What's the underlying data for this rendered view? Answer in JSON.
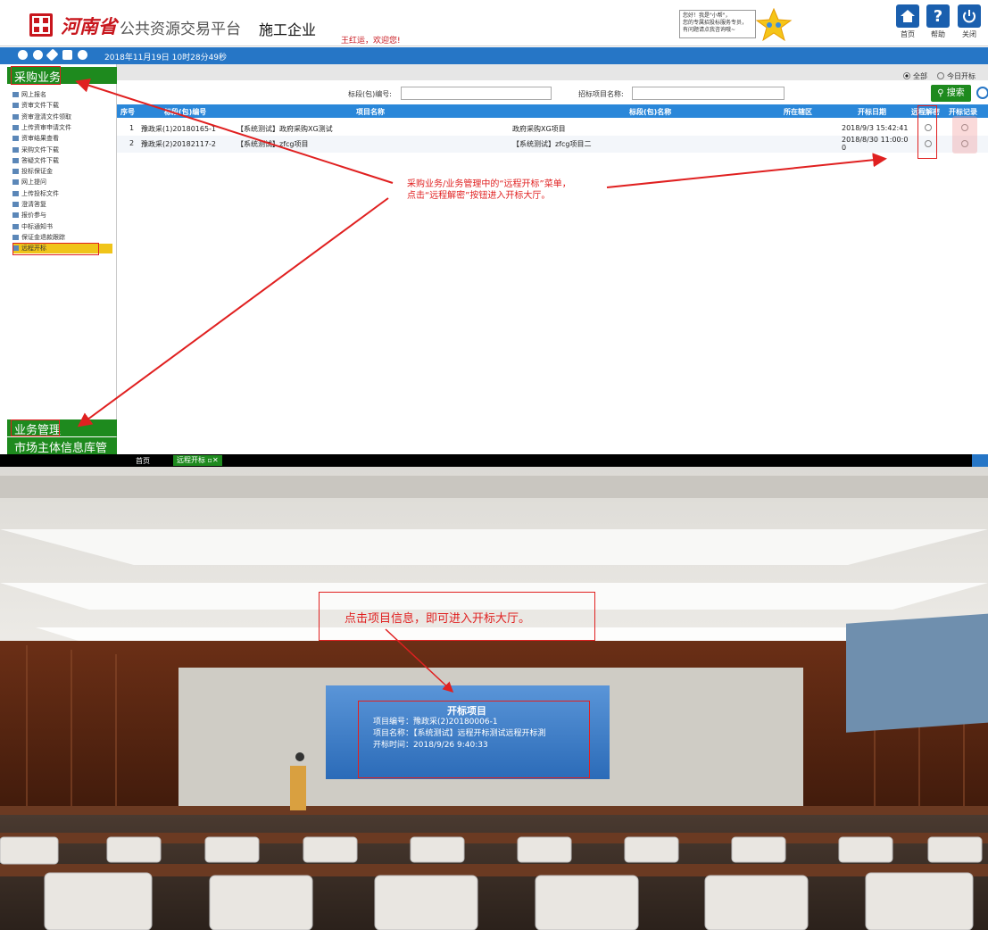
{
  "header": {
    "province": "河南省",
    "platform": "公共资源交易平台",
    "enterprise": "施工企业",
    "welcome": "王红运，欢迎您!",
    "assistant_text": "您好！我是\"小帮\"，\n您的专属招投标服务专员，\n有问题请点我咨询哦~",
    "buttons": [
      {
        "label": "首页"
      },
      {
        "label": "帮助"
      },
      {
        "label": "关闭"
      }
    ]
  },
  "toolbar": {
    "datetime": "2018年11月19日 10时28分49秒"
  },
  "sidebar": {
    "section_purchase": "采购业务",
    "items": [
      {
        "label": "网上报名"
      },
      {
        "label": "资审文件下载"
      },
      {
        "label": "资审澄清文件领取"
      },
      {
        "label": "上传资审申请文件"
      },
      {
        "label": "资审结果查看"
      },
      {
        "label": "采购文件下载"
      },
      {
        "label": "答疑文件下载"
      },
      {
        "label": "投标保证金"
      },
      {
        "label": "网上提问"
      },
      {
        "label": "上传投标文件"
      },
      {
        "label": "澄清答复"
      },
      {
        "label": "报价参与"
      },
      {
        "label": "中标通知书"
      },
      {
        "label": "保证金退款跟踪"
      },
      {
        "label": "远程开标"
      }
    ],
    "section_business": "业务管理",
    "section_market": "市场主体信息库管理"
  },
  "filters": {
    "radio_all": "全部",
    "radio_today": "今日开标",
    "section_no_label": "标段(包)编号:",
    "project_name_label": "招标项目名称:",
    "search_label": "搜索"
  },
  "table": {
    "headers": [
      "序号",
      "标段(包)编号",
      "项目名称",
      "标段(包)名称",
      "所在辖区",
      "开标日期",
      "远程解密",
      "开标记录"
    ],
    "rows": [
      {
        "no": "1",
        "code": "豫政采(1)20180165-1",
        "project": "【系统测试】政府采购XG测试",
        "section": "政府采购XG项目",
        "region": "",
        "date": "2018/9/3 15:42:41"
      },
      {
        "no": "2",
        "code": "豫政采(2)20182117-2",
        "project": "【系统测试】zfcg项目",
        "section": "【系统测试】zfcg项目二",
        "region": "",
        "date": "2018/8/30 11:00:0\n0"
      }
    ]
  },
  "annotation_top": {
    "line1": "采购业务/业务管理中的“远程开标”菜单，",
    "line2": "点击“远程解密”按钮进入开标大厅。"
  },
  "tabs": [
    {
      "label": "首页"
    },
    {
      "label": "远程开标"
    }
  ],
  "hall": {
    "annotation": "点击项目信息，即可进入开标大厅。",
    "screen_title": "开标项目",
    "project_no_label": "项目编号：",
    "project_no": "豫政采(2)20180006-1",
    "project_name_label": "项目名称：",
    "project_name": "【系统测试】远程开标测试远程开标測",
    "open_time_label": "开标时间：",
    "open_time": "2018/9/26 9:40:33"
  },
  "colors": {
    "brand_red": "#c8161d",
    "nav_blue": "#2676c6",
    "menu_green": "#1e8a1e",
    "annotation_red": "#e02020"
  }
}
